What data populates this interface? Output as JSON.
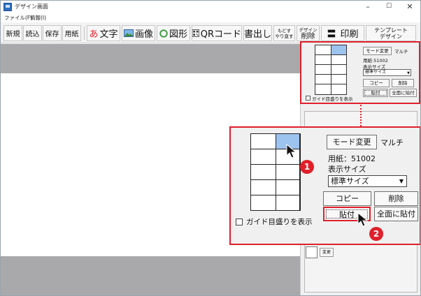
{
  "window": {
    "title": "デザイン画面",
    "controls": {
      "minimize": "–",
      "maximize": "☐",
      "close": "✕"
    }
  },
  "menu": {
    "file": "ファイル(F)",
    "info": "情報(I)"
  },
  "toolbar": {
    "new": "新規",
    "load": "読込",
    "save": "保存",
    "paper": "用紙",
    "text_glyph": "あ",
    "text": "文字",
    "image": "画像",
    "shape": "図形",
    "qr": "QRコード",
    "export": "書出し",
    "undo_line1": "もどす",
    "undo_line2": "やり直す",
    "design_delete_line1": "デザイン",
    "design_delete_line2": "削除",
    "print_glyph": "〓",
    "print": "印刷",
    "template_line1": "テンプレート",
    "template_line2": "デザイン"
  },
  "small_panel": {
    "mode_change": "モード変更",
    "multi": "マルチ",
    "paper_code": "用紙:51002",
    "display_size_label": "表示サイズ",
    "display_size_value": "標準サイズ",
    "copy": "コピー",
    "delete": "削除",
    "paste": "貼付",
    "paste_all": "全面に貼付",
    "guide_label": "ガイド目盛りを表示"
  },
  "zoom_panel": {
    "mode_change": "モード変更",
    "multi": "マルチ",
    "paper_code": "用紙：51002",
    "display_size_label": "表示サイズ",
    "display_size_value": "標準サイズ",
    "copy": "コピー",
    "delete": "削除",
    "paste": "貼付",
    "paste_all": "全面に貼付",
    "guide_label": "ガイド目盛りを表示"
  },
  "markers": {
    "step1": "1",
    "step2": "2"
  },
  "swatch": {
    "change": "変更"
  },
  "colors": {
    "accent": "#e0202a",
    "selected_cell": "#9dc3ef",
    "canvas_gray": "#a9a9ab"
  }
}
